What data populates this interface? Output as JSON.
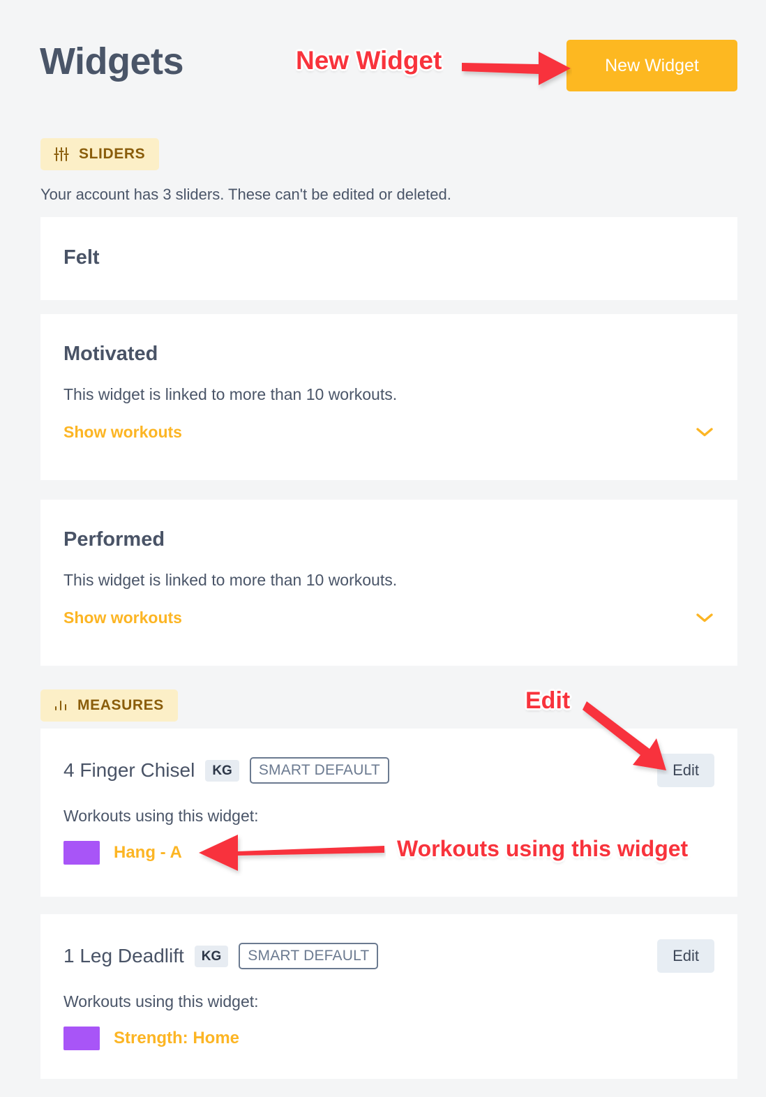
{
  "header": {
    "title": "Widgets",
    "new_widget_button": "New Widget"
  },
  "sections": [
    {
      "badge_label": "SLIDERS",
      "badge_icon": "sliders-icon",
      "note": "Your account has 3 sliders. These can't be edited or deleted.",
      "cards": [
        {
          "title": "Felt",
          "description": "",
          "link": "",
          "chevron": "chevron-down-icon"
        },
        {
          "title": "Motivated",
          "description": "This widget is linked to more than 10 workouts.",
          "link": "Show workouts",
          "chevron": "chevron-down-icon"
        },
        {
          "title": "Performed",
          "description": "This widget is linked to more than 10 workouts.",
          "link": "Show workouts",
          "chevron": "chevron-down-icon"
        }
      ]
    },
    {
      "badge_label": "MEASURES",
      "badge_icon": "bar-chart-icon",
      "note": "",
      "measures": [
        {
          "name": "4 Finger Chisel",
          "unit": "KG",
          "tag": "SMART DEFAULT",
          "edit_label": "Edit",
          "workouts_label": "Workouts using this widget:",
          "workouts": [
            {
              "name": "Hang - A",
              "color": "#a855f7"
            }
          ]
        },
        {
          "name": "1 Leg Deadlift",
          "unit": "KG",
          "tag": "SMART DEFAULT",
          "edit_label": "Edit",
          "workouts_label": "Workouts using this widget:",
          "workouts": [
            {
              "name": "Strength: Home",
              "color": "#a855f7"
            }
          ]
        }
      ]
    }
  ],
  "annotations": [
    {
      "text": "New Widget",
      "color": "#f8333c"
    },
    {
      "text": "Edit",
      "color": "#f8333c"
    },
    {
      "text": "Workouts using this widget",
      "color": "#f8333c"
    }
  ],
  "colors": {
    "page_background": "#f4f5f6",
    "card_background": "#ffffff",
    "accent_amber": "#fcb524",
    "button_amber": "#fdb821",
    "badge_background": "#fcefc7",
    "badge_text": "#8a5d0b",
    "title_slate": "#4a5568",
    "annotation_red": "#f8333c",
    "workout_swatch_purple": "#a855f7"
  }
}
